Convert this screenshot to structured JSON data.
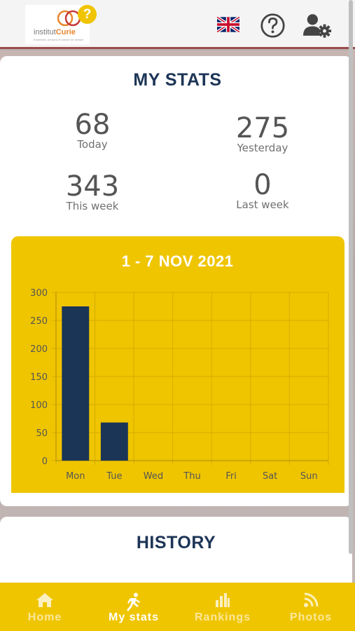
{
  "header": {
    "logo_prefix": "institut",
    "logo_brand": "Curie",
    "logo_tagline": "Ensemble, prenons le cancer de vitesse",
    "help_badge": "?",
    "icons": [
      "uk-flag-icon",
      "help-circle-icon",
      "user-settings-icon"
    ]
  },
  "stats": {
    "title": "MY STATS",
    "today_value": "68",
    "today_label": "Today",
    "yesterday_value": "275",
    "yesterday_label": "Yesterday",
    "week_value": "343",
    "week_label": "This week",
    "lastweek_value": "0",
    "lastweek_label": "Last week"
  },
  "chart_title": "1 - 7 NOV 2021",
  "chart_data": {
    "type": "bar",
    "title": "1 - 7 NOV 2021",
    "categories": [
      "Mon",
      "Tue",
      "Wed",
      "Thu",
      "Fri",
      "Sat",
      "Sun"
    ],
    "values": [
      275,
      68,
      0,
      0,
      0,
      0,
      0
    ],
    "yticks": [
      0,
      50,
      100,
      150,
      200,
      250,
      300
    ],
    "ylim": [
      0,
      300
    ],
    "grid": true,
    "bar_color": "#1b3557",
    "background": "#efc500"
  },
  "history": {
    "title": "HISTORY"
  },
  "nav": {
    "home": "Home",
    "stats": "My stats",
    "rankings": "Rankings",
    "photos": "Photos"
  },
  "colors": {
    "accent": "#efc500",
    "navy": "#1d3557"
  }
}
